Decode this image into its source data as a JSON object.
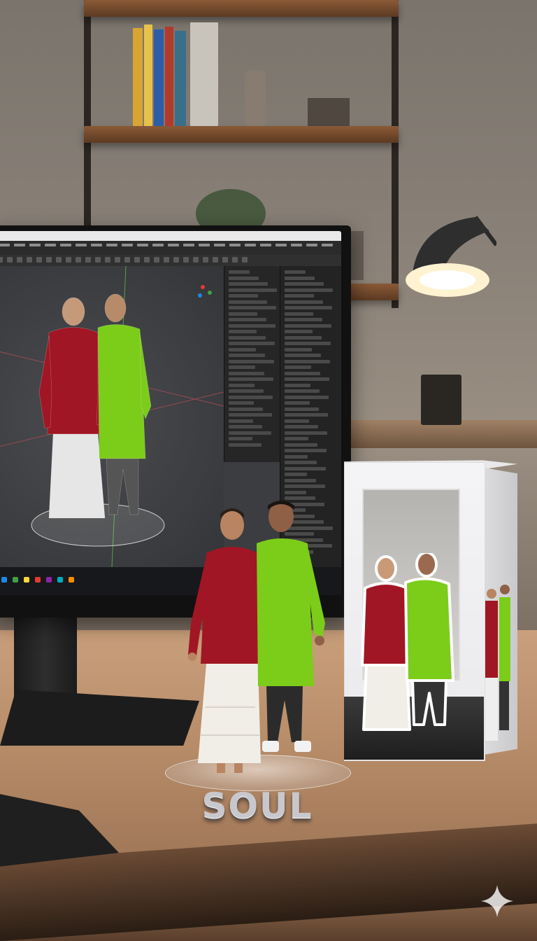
{
  "scene": {
    "description_kind": "photo",
    "elements": [
      "monitor-3d-software",
      "figurine",
      "product-box"
    ]
  },
  "screen": {
    "titlebar_text": "",
    "menu_count": 22,
    "taskbar_icons": [
      "#1e88e5",
      "#43a047",
      "#fdd835",
      "#e53935",
      "#8e24aa",
      "#00acc1",
      "#fb8c00"
    ]
  },
  "figurine": {
    "brand_text": "SOUL"
  },
  "colors": {
    "kurta_red": "#a11624",
    "kurta_green": "#7ccc1a",
    "lamp_glow": "#fff2d0",
    "accent_star": "#ffffff"
  }
}
